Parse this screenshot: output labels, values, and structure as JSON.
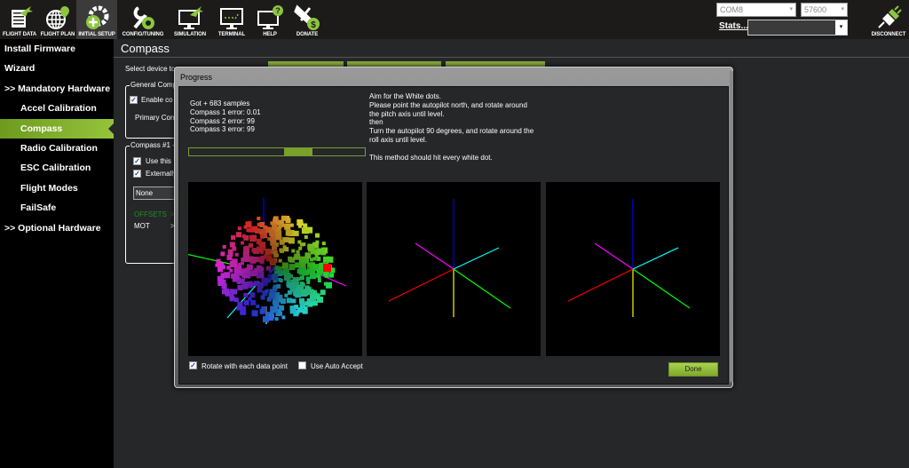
{
  "topnav": {
    "items": [
      {
        "label": "FLIGHT DATA",
        "icon": "flight-data-icon"
      },
      {
        "label": "FLIGHT PLAN",
        "icon": "flight-plan-icon"
      },
      {
        "label": "INITIAL SETUP",
        "icon": "initial-setup-icon",
        "active": true
      },
      {
        "label": "CONFIG/TUNING",
        "icon": "config-tuning-icon"
      },
      {
        "label": "SIMULATION",
        "icon": "simulation-icon"
      },
      {
        "label": "TERMINAL",
        "icon": "terminal-icon"
      },
      {
        "label": "HELP",
        "icon": "help-icon"
      },
      {
        "label": "DONATE",
        "icon": "donate-icon"
      }
    ],
    "port": "COM8",
    "baud": "57600",
    "stats_label": "Stats...",
    "stats_value": "",
    "disconnect_label": "DISCONNECT"
  },
  "sidebar": {
    "items": [
      {
        "label": "Install Firmware"
      },
      {
        "label": "Wizard"
      },
      {
        "label": ">> Mandatory Hardware"
      },
      {
        "label": "Accel Calibration"
      },
      {
        "label": "Compass",
        "selected": true
      },
      {
        "label": "Radio Calibration"
      },
      {
        "label": "ESC Calibration"
      },
      {
        "label": "Flight Modes"
      },
      {
        "label": "FailSafe"
      },
      {
        "label": ">> Optional Hardware"
      }
    ]
  },
  "main": {
    "title": "Compass",
    "select_device_label": "Select device to",
    "general_group": {
      "title": "General Comp",
      "enable_label": "Enable co",
      "enable_checked": true,
      "primary_label": "Primary Com"
    },
    "compass1_group": {
      "title": "Compass #1 -",
      "use_label": "Use this",
      "use_checked": true,
      "external_label": "Externally",
      "external_checked": true,
      "orientation": "None",
      "offsets_label": "OFFSETS",
      "offsets_arrow": ">",
      "mot_label": "MOT",
      "mot_arrow": ">"
    }
  },
  "dialog": {
    "title": "Progress",
    "samples": "Got + 683 samples",
    "errors": [
      "Compass 1 error: 0.01",
      "Compass 2 error: 99",
      "Compass 3 error: 99"
    ],
    "instructions": [
      "Aim for the White dots.",
      "Please point the autopilot north, and rotate around",
      "the pitch axis until level.",
      "then",
      "Turn the autopilot 90 degrees, and rotate around the",
      "roll axis until level.",
      "",
      "This method should hit every white dot."
    ],
    "progress_start": 0.54,
    "progress_end": 0.7,
    "rotate_label": "Rotate with each data point",
    "rotate_checked": true,
    "auto_accept_label": "Use Auto Accept",
    "auto_accept_checked": false,
    "done_label": "Done",
    "axis_colors": {
      "up": "#0000ff",
      "down": "#ffff00",
      "left_back": "#ff00ff",
      "right_back": "#00ffff",
      "left_front": "#ff0000",
      "right_front": "#00ff00"
    }
  }
}
